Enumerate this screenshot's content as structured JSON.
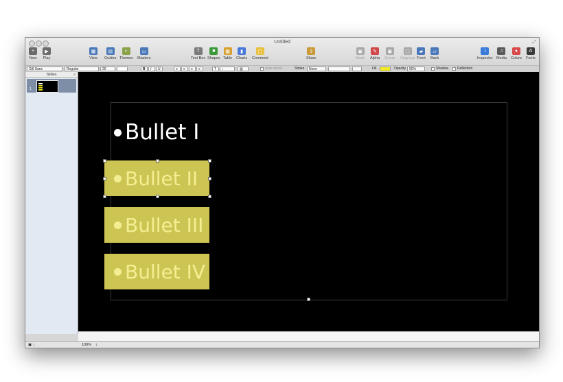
{
  "window": {
    "title": "Untitled"
  },
  "toolbar": [
    {
      "id": "new",
      "label": "New",
      "icon": "plus-icon",
      "glyph": "+",
      "color": "#6a6a6a"
    },
    {
      "id": "play",
      "label": "Play",
      "icon": "play-icon",
      "glyph": "▶",
      "color": "#6a6a6a"
    },
    {
      "id": "view",
      "label": "View",
      "icon": "view-icon",
      "glyph": "▦",
      "color": "#4a78b8"
    },
    {
      "id": "guides",
      "label": "Guides",
      "icon": "guides-icon",
      "glyph": "▤",
      "color": "#4a78b8"
    },
    {
      "id": "themes",
      "label": "Themes",
      "icon": "themes-icon",
      "glyph": "◐",
      "color": "#8aa34a"
    },
    {
      "id": "masters",
      "label": "Masters",
      "icon": "masters-icon",
      "glyph": "▭",
      "color": "#4a78b8"
    },
    {
      "id": "textbox",
      "label": "Text Box",
      "icon": "text-box-icon",
      "glyph": "T",
      "color": "#7a7a7a"
    },
    {
      "id": "shapes",
      "label": "Shapes",
      "icon": "shapes-icon",
      "glyph": "■",
      "color": "#3a9a3a"
    },
    {
      "id": "table",
      "label": "Table",
      "icon": "table-icon",
      "glyph": "▦",
      "color": "#d8a030"
    },
    {
      "id": "charts",
      "label": "Charts",
      "icon": "charts-icon",
      "glyph": "▮",
      "color": "#4a78d8"
    },
    {
      "id": "comment",
      "label": "Comment",
      "icon": "comment-icon",
      "glyph": "▢",
      "color": "#e8c040"
    },
    {
      "id": "share",
      "label": "Share",
      "icon": "share-icon",
      "glyph": "⇪",
      "color": "#c89a38"
    },
    {
      "id": "mask",
      "label": "Mask",
      "icon": "mask-icon",
      "glyph": "▣",
      "color": "#a8a8a8",
      "dim": true
    },
    {
      "id": "alpha",
      "label": "Alpha",
      "icon": "alpha-icon",
      "glyph": "✎",
      "color": "#d04848"
    },
    {
      "id": "group",
      "label": "Group",
      "icon": "group-icon",
      "glyph": "▣",
      "color": "#a8a8a8",
      "dim": true
    },
    {
      "id": "ungroup",
      "label": "Ungroup",
      "icon": "ungroup-icon",
      "glyph": "▢",
      "color": "#a8a8a8",
      "dim": true
    },
    {
      "id": "front",
      "label": "Front",
      "icon": "front-icon",
      "glyph": "▰",
      "color": "#4a78b8"
    },
    {
      "id": "back",
      "label": "Back",
      "icon": "back-icon",
      "glyph": "▱",
      "color": "#4a78b8"
    },
    {
      "id": "inspector",
      "label": "Inspector",
      "icon": "inspector-icon",
      "glyph": "i",
      "color": "#3a7ad8"
    },
    {
      "id": "media",
      "label": "Media",
      "icon": "media-icon",
      "glyph": "♫",
      "color": "#5a5a5a"
    },
    {
      "id": "colors",
      "label": "Colors",
      "icon": "colors-icon",
      "glyph": "●",
      "color": "#d84a4a"
    },
    {
      "id": "fonts",
      "label": "Fonts",
      "icon": "fonts-icon",
      "glyph": "A",
      "color": "#3a3a3a"
    }
  ],
  "formatbar": {
    "font": "Gill Sans",
    "style": "Regular",
    "size": "26",
    "bold": "B",
    "italic": "I",
    "underline": "U",
    "autoshrink": "Auto-shrink",
    "stroke_label": "Stroke",
    "stroke_value": "None",
    "fill_label": "Fill",
    "fill_color": "#f4ec20",
    "opacity_label": "Opacity",
    "opacity_value": "80%",
    "shadow": "Shadow",
    "reflection": "Reflection"
  },
  "sidebar": {
    "title": "Slides",
    "slide_number": "1"
  },
  "slide": {
    "bullets": [
      "Bullet I",
      "Bullet II",
      "Bullet III",
      "Bullet IV"
    ],
    "highlight_color": "#cdc553",
    "highlight_text_color": "#f4ee92"
  },
  "status": {
    "zoom": "100%"
  }
}
